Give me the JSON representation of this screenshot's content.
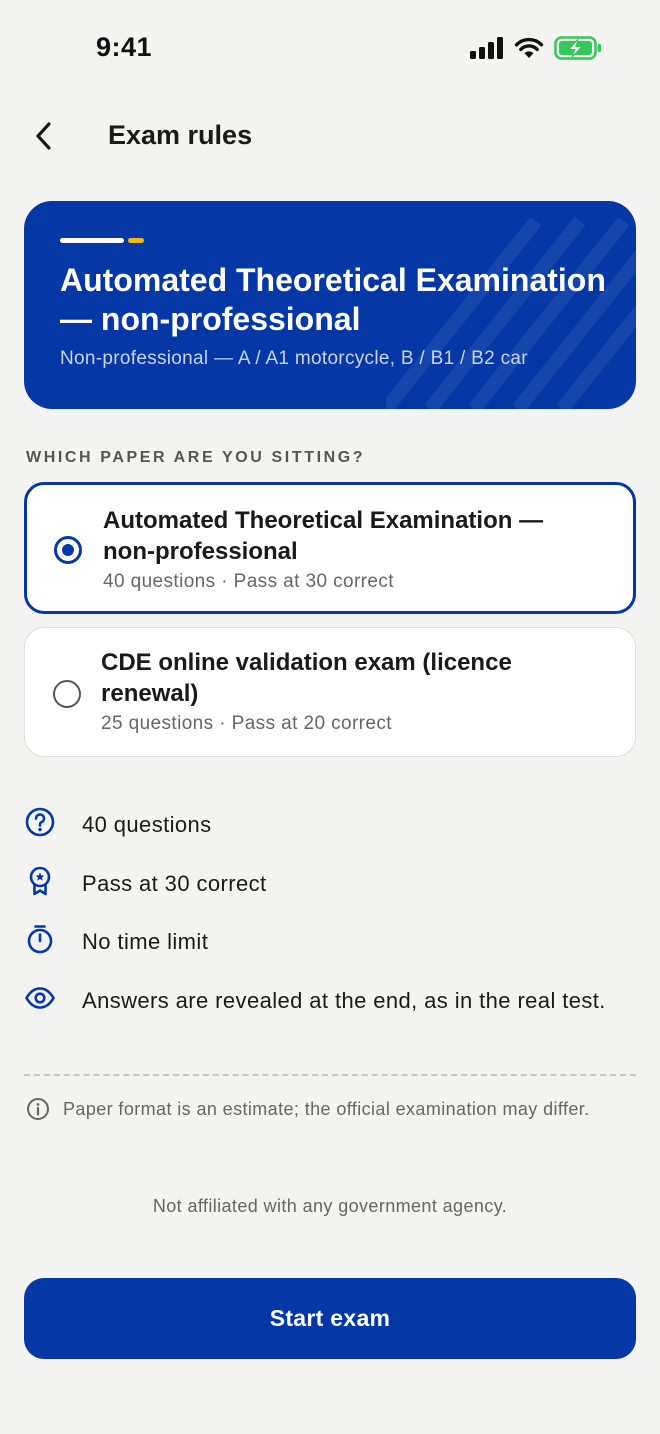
{
  "status_bar": {
    "time": "9:41"
  },
  "nav": {
    "title": "Exam rules"
  },
  "hero": {
    "title": "Automated Theoretical Examination — non-professional",
    "subtitle": "Non-professional — A / A1 motorcycle, B / B1 / B2 car"
  },
  "paper_picker": {
    "label": "WHICH PAPER ARE YOU SITTING?",
    "options": [
      {
        "title": "Automated Theoretical Examination — non-professional",
        "meta": "40 questions · Pass at 30 correct",
        "selected": true
      },
      {
        "title": "CDE online validation exam (licence renewal)",
        "meta": "25 questions · Pass at 20 correct",
        "selected": false
      }
    ]
  },
  "rules": [
    {
      "icon": "question-circle-icon",
      "text": "40 questions"
    },
    {
      "icon": "award-ribbon-icon",
      "text": "Pass at 30 correct"
    },
    {
      "icon": "stopwatch-icon",
      "text": "No time limit"
    },
    {
      "icon": "eye-icon",
      "text": "Answers are revealed at the end, as in the real test."
    }
  ],
  "note": {
    "icon": "info-icon",
    "text": "Paper format is an estimate; the official examination may differ."
  },
  "disclaimer": "Not affiliated with any government agency.",
  "cta": {
    "label": "Start exam"
  },
  "colors": {
    "brand": "#0538a6",
    "accent": "#f5b90a",
    "battery": "#34c759",
    "background": "#f3f3f2"
  }
}
